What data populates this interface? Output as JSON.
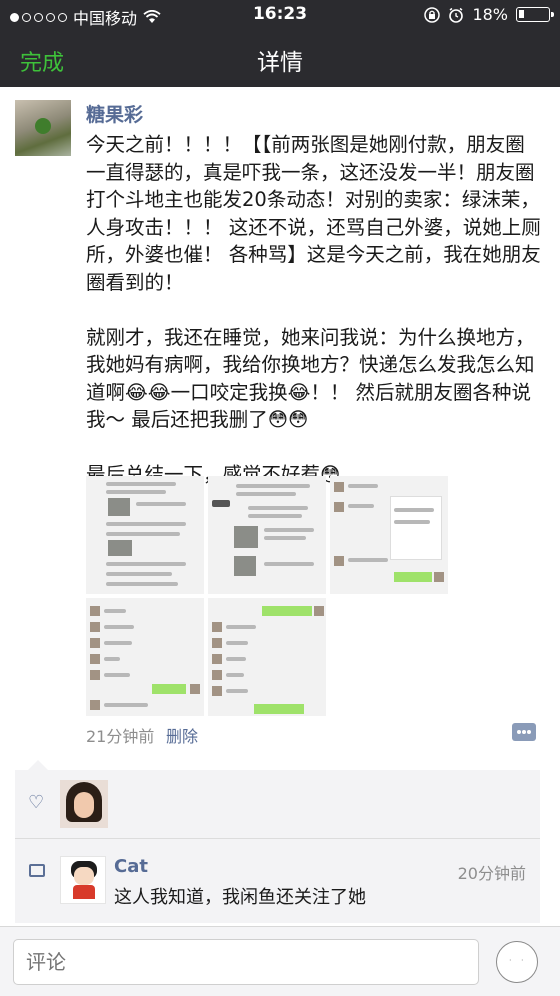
{
  "status_bar": {
    "carrier": "中国移动",
    "time": "16:23",
    "battery": "18%",
    "signal_dots_filled": 1,
    "signal_dots_total": 5,
    "battery_level": 0.18
  },
  "nav": {
    "done_label": "完成",
    "title": "详情"
  },
  "post": {
    "author": "糖果彩",
    "text": "今天之前！！！！【【前两张图是她刚付款，朋友圈一直得瑟的，真是吓我一条，这还没发一半！朋友圈打个斗地主也能发20条动态！对别的卖家：绿沫茉，人身攻击！！！ 这还不说，还骂自己外婆，说她上厕所，外婆也催！ 各种骂】这是今天之前，我在她朋友圈看到的！\n\n就刚才，我还在睡觉，她来问我说：为什么换地方，我她妈有病啊，我给你换地方？快递怎么发我怎么知道啊😂😂一口咬定我换😂！！ 然后就朋友圈各种说我～ 最后还把我删了😳😳\n\n最后总结一下，感觉不好惹😳",
    "time": "21分钟前",
    "delete_label": "删除",
    "image_count": 5
  },
  "comments_area": {
    "comments": [
      {
        "name": "Cat",
        "time": "20分钟前",
        "text": "这人我知道，我闲鱼还关注了她"
      }
    ]
  },
  "input": {
    "placeholder": "评论"
  },
  "colors": {
    "topbar": "#2b2b2f",
    "accent_green": "#3ec13a",
    "name_blue": "#566b95",
    "bubble_green": "#9fe26a"
  },
  "icons": [
    "wifi-icon",
    "lock-icon",
    "alarm-icon",
    "heart-icon",
    "comment-icon",
    "emoji-icon",
    "comment-action-icon"
  ]
}
